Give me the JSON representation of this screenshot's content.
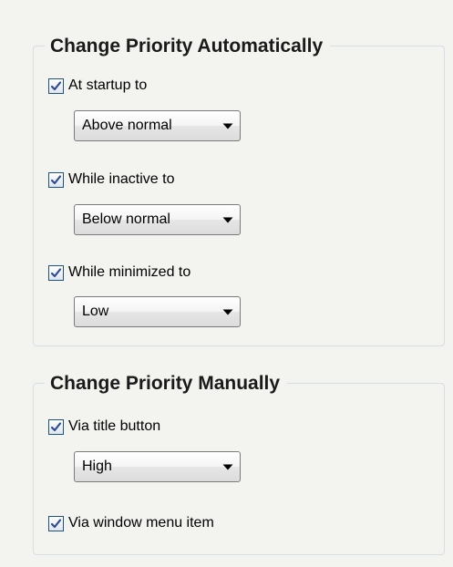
{
  "auto_group": {
    "title": "Change Priority Automatically",
    "items": [
      {
        "label": "At startup to",
        "checked": true,
        "selected": "Above normal"
      },
      {
        "label": "While inactive to",
        "checked": true,
        "selected": "Below normal"
      },
      {
        "label": "While minimized to",
        "checked": true,
        "selected": "Low"
      }
    ]
  },
  "manual_group": {
    "title": "Change Priority Manually",
    "title_button": {
      "label": "Via title button",
      "checked": true,
      "selected": "High"
    },
    "window_menu": {
      "label": "Via window menu item",
      "checked": true
    }
  },
  "icons": {
    "checkbox_mark": "checkmark-icon",
    "combo_arrow": "chevron-down-icon"
  },
  "colors": {
    "background": "#f3f3f0",
    "group_border": "#d5dfe5",
    "check_mark": "#2d4b9a",
    "checkbox_border": "#1c5180"
  }
}
